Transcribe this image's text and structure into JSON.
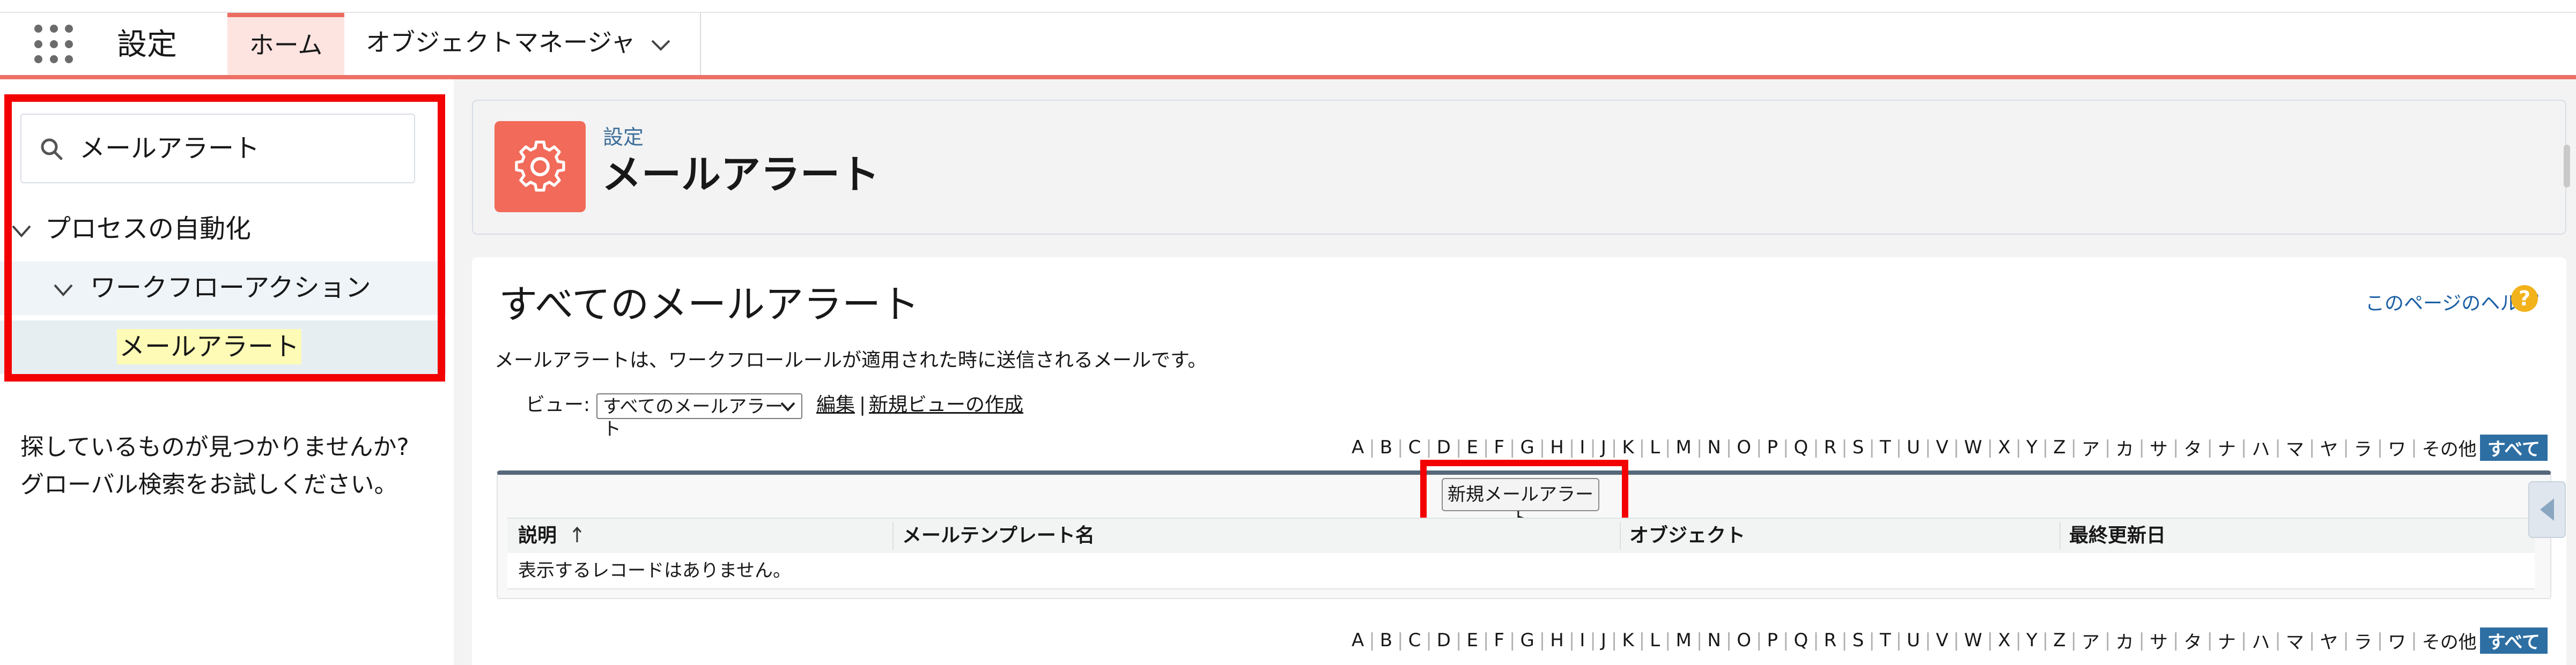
{
  "topnav": {
    "app_name": "設定",
    "tabs": [
      {
        "label": "ホーム",
        "active": true
      },
      {
        "label": "オブジェクトマネージャ",
        "active": false
      }
    ]
  },
  "sidebar": {
    "search_value": "メールアラート",
    "tree": [
      {
        "label": "プロセスの自動化",
        "level": 1,
        "expanded": true
      },
      {
        "label": "ワークフローアクション",
        "level": 2,
        "expanded": true
      },
      {
        "label": "メールアラート",
        "level": 3,
        "highlighted": true
      }
    ],
    "help_line1": "探しているものが見つかりませんか?",
    "help_line2": "グローバル検索をお試しください。"
  },
  "header": {
    "breadcrumb": "設定",
    "title": "メールアラート"
  },
  "content": {
    "page_title": "すべてのメールアラート",
    "help_link": "このページのヘルプ",
    "help_badge": "?",
    "description": "メールアラートは、ワークフロールールが適用された時に送信されるメールです。",
    "view_label": "ビュー:",
    "view_selected": "すべてのメールアラート",
    "view_edit": "編集",
    "view_separator": "|",
    "view_new": "新規ビューの作成",
    "alphabet": [
      "A",
      "B",
      "C",
      "D",
      "E",
      "F",
      "G",
      "H",
      "I",
      "J",
      "K",
      "L",
      "M",
      "N",
      "O",
      "P",
      "Q",
      "R",
      "S",
      "T",
      "U",
      "V",
      "W",
      "X",
      "Y",
      "Z",
      "ア",
      "カ",
      "サ",
      "タ",
      "ナ",
      "ハ",
      "マ",
      "ヤ",
      "ラ",
      "ワ",
      "その他",
      "すべて"
    ],
    "alphabet_active": "すべて",
    "new_button": "新規メールアラート",
    "columns": [
      "説明",
      "メールテンプレート名",
      "オブジェクト",
      "最終更新日"
    ],
    "sorted_column": "説明",
    "empty_message": "表示するレコードはありません。"
  },
  "colors": {
    "accent_red": "#ec7066",
    "header_icon": "#f26a59",
    "link_blue": "#1b5fa5",
    "highlight_box": "#f30000",
    "alphabet_active_bg": "#2e6fa3"
  }
}
